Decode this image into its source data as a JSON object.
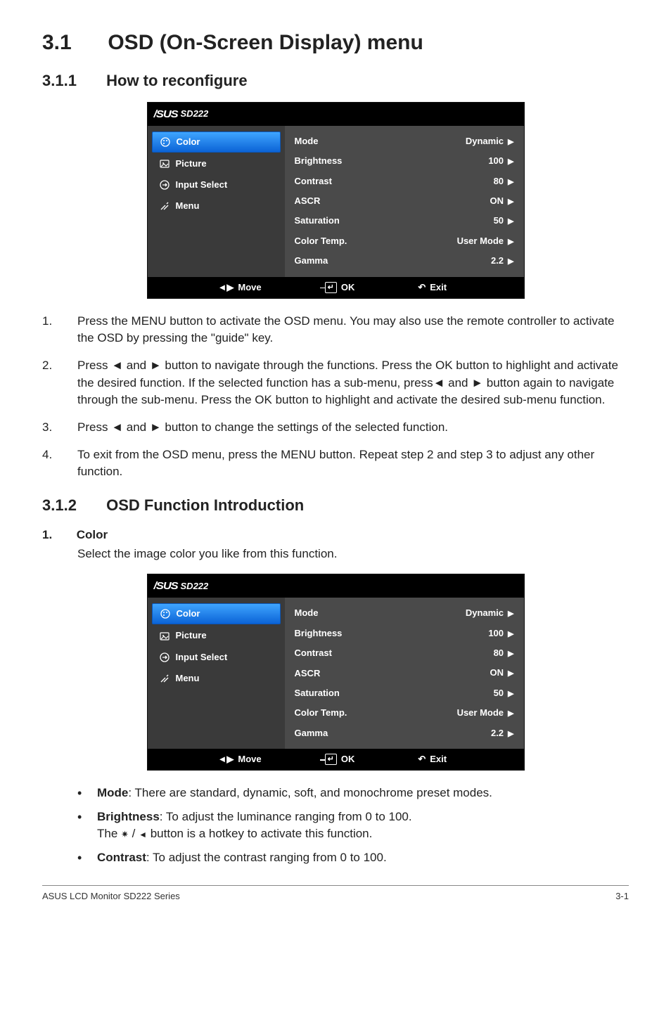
{
  "section": {
    "number": "3.1",
    "title": "OSD (On-Screen Display) menu"
  },
  "sub1": {
    "number": "3.1.1",
    "title": "How to reconfigure"
  },
  "sub2": {
    "number": "3.1.2",
    "title": "OSD Function Introduction"
  },
  "osd": {
    "model": "SD222",
    "nav": {
      "color": "Color",
      "picture": "Picture",
      "input_select": "Input Select",
      "menu": "Menu"
    },
    "rows": {
      "mode": {
        "label": "Mode",
        "value": "Dynamic"
      },
      "brightness": {
        "label": "Brightness",
        "value": "100"
      },
      "contrast": {
        "label": "Contrast",
        "value": "80"
      },
      "ascr": {
        "label": "ASCR",
        "value": "ON"
      },
      "saturation": {
        "label": "Saturation",
        "value": "50"
      },
      "colortemp": {
        "label": "Color Temp.",
        "value": "User Mode"
      },
      "gamma": {
        "label": "Gamma",
        "value": "2.2"
      }
    },
    "footer": {
      "move": "Move",
      "ok": "OK",
      "exit": "Exit"
    }
  },
  "steps": {
    "s1": "Press the MENU button to activate the OSD menu. You may also use the remote controller to activate the OSD by pressing the \"guide\" key.",
    "s2a": "Press ",
    "s2b": " and ",
    "s2c": " button to navigate through the functions. Press the OK button to highlight and activate the desired function. If the selected function has a sub-menu, press",
    "s2d": " and ",
    "s2e": " button again to navigate through the sub-menu. Press the OK button to highlight and activate the desired sub-menu function.",
    "s3a": "Press ",
    "s3b": " and ",
    "s3c": " button to change the settings of the selected function.",
    "s4": "To exit from the OSD menu, press the MENU button. Repeat step 2 and step 3 to adjust any other function."
  },
  "colorSection": {
    "num": "1.",
    "label": "Color",
    "desc": "Select the image color you like from this function."
  },
  "bullets": {
    "mode_label": "Mode",
    "mode_text": ": There are standard, dynamic, soft, and monochrome preset modes.",
    "brightness_label": "Brightness",
    "brightness_text1": ": To adjust the luminance ranging from 0 to 100.",
    "brightness_text2a": "The ",
    "brightness_text2b": " button is a hotkey to activate this function.",
    "contrast_label": "Contrast",
    "contrast_text": ": To adjust the contrast ranging from 0 to 100."
  },
  "footer": {
    "left": "ASUS LCD Monitor SD222 Series",
    "right": "3-1"
  },
  "glyphs": {
    "left_tri": "◄",
    "right_tri": "►",
    "small_right": "▶",
    "lr": "◄▶",
    "undo": "↶",
    "slash": " / "
  }
}
